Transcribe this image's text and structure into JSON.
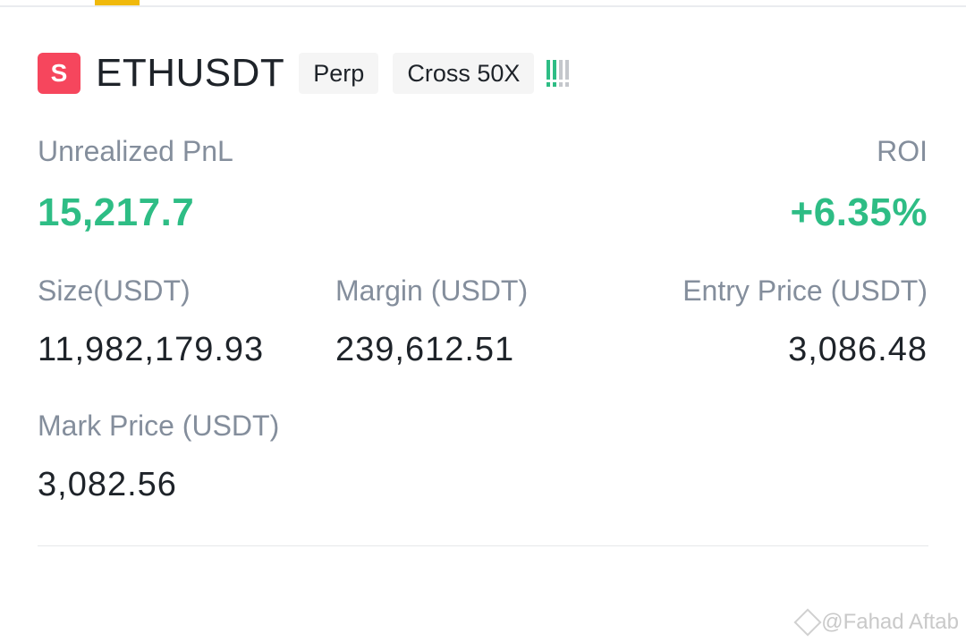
{
  "position": {
    "side_badge": "S",
    "symbol": "ETHUSDT",
    "contract_type": "Perp",
    "margin_mode": "Cross 50X",
    "risk_colors": [
      "#2ebd85",
      "#2ebd85",
      "#c4c7cc",
      "#c4c7cc"
    ],
    "unrealized_pnl_label": "Unrealized PnL",
    "unrealized_pnl_value": "15,217.7",
    "roi_label": "ROI",
    "roi_value": "+6.35%",
    "size_label": "Size(USDT)",
    "size_value": "11,982,179.93",
    "margin_label": "Margin (USDT)",
    "margin_value": "239,612.51",
    "entry_label": "Entry Price (USDT)",
    "entry_value": "3,086.48",
    "mark_label": "Mark Price (USDT)",
    "mark_value": "3,082.56"
  },
  "colors": {
    "sell": "#f6465d",
    "profit": "#2ebd85",
    "accent": "#f0b90b"
  },
  "watermark": "@Fahad Aftab"
}
